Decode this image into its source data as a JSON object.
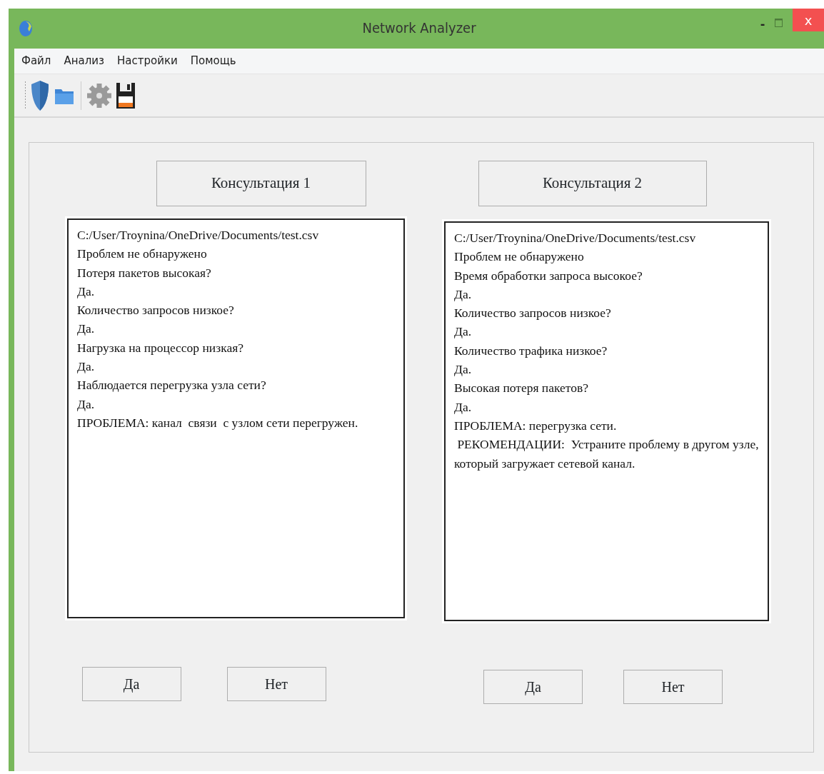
{
  "window": {
    "title": "Network Analyzer",
    "minimize_label": "-",
    "close_label": "x"
  },
  "menu": [
    "Файл",
    "Анализ",
    "Настройки",
    "Помощь"
  ],
  "consultations": [
    {
      "title": "Консультация 1",
      "lines": [
        "C:/User/Troynina/OneDrive/Documents/test.csv",
        "Проблем не обнаружено",
        "Потеря пакетов высокая?",
        "Да.",
        "Количество запросов низкое?",
        "Да.",
        "Нагрузка на процессор низкая?",
        "Да.",
        "Наблюдается перегрузка узла сети?",
        "Да.",
        "ПРОБЛЕМА: канал  связи  с узлом сети перегружен."
      ],
      "buttons": [
        "Да",
        "Нет"
      ]
    },
    {
      "title": "Консультация 2",
      "lines": [
        "C:/User/Troynina/OneDrive/Documents/test.csv",
        "Проблем не обнаружено",
        "Время обработки запроса высокое?",
        "Да.",
        "Количество запросов низкое?",
        "Да.",
        "Количество трафика низкое?",
        "Да.",
        "Высокая потеря пакетов?",
        "Да.",
        "ПРОБЛЕМА: перегрузка сети.",
        " РЕКОМЕНДАЦИИ:  Устраните проблему в другом узле, который загружает сетевой канал."
      ],
      "buttons": [
        "Да",
        "Нет"
      ]
    }
  ]
}
